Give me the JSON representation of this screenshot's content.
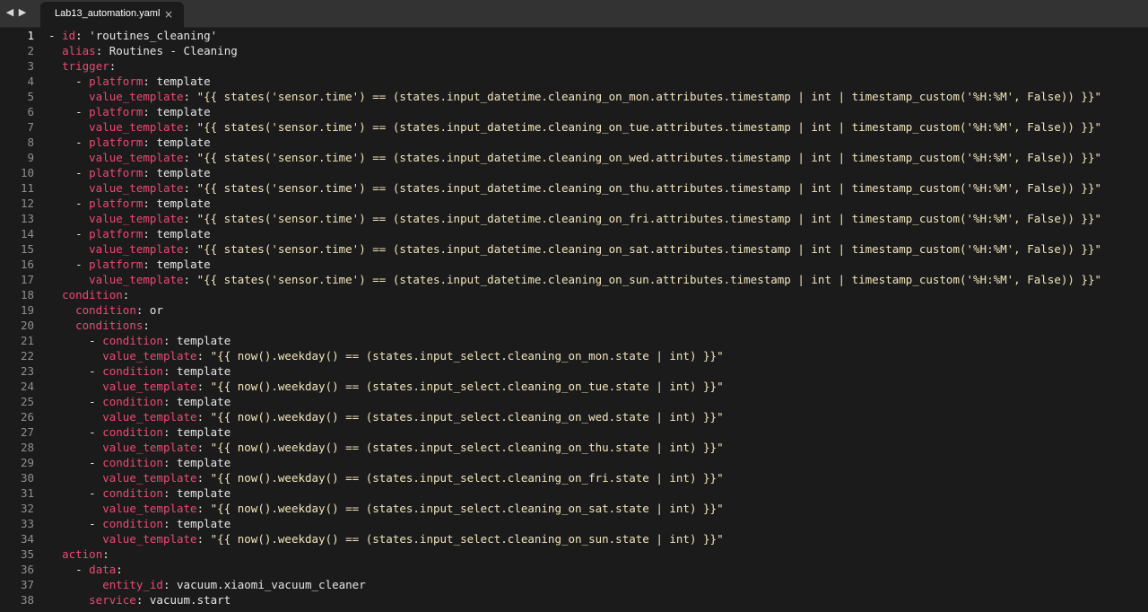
{
  "tab": {
    "title": "Lab13_automation.yaml",
    "close_glyph": "×"
  },
  "nav": {
    "back_glyph": "◀",
    "forward_glyph": "▶"
  },
  "colors": {
    "key": "#ec4a73",
    "text": "#e6e6e6",
    "string": "#f2e5bc",
    "background": "#1b1b1b",
    "tabbar": "#333333"
  },
  "editor": {
    "current_line": 1,
    "lines": [
      {
        "n": "1",
        "indent": "",
        "dash": "- ",
        "key": "id",
        "value": "'routines_cleaning'"
      },
      {
        "n": "2",
        "indent": "  ",
        "dash": "",
        "key": "alias",
        "value": "Routines - Cleaning"
      },
      {
        "n": "3",
        "indent": "  ",
        "dash": "",
        "key": "trigger",
        "value": ""
      },
      {
        "n": "4",
        "indent": "    ",
        "dash": "- ",
        "key": "platform",
        "value": "template"
      },
      {
        "n": "5",
        "indent": "      ",
        "dash": "",
        "key": "value_template",
        "value": "\"{{ states('sensor.time') == (states.input_datetime.cleaning_on_mon.attributes.timestamp | int | timestamp_custom('%H:%M', False)) }}\""
      },
      {
        "n": "6",
        "indent": "    ",
        "dash": "- ",
        "key": "platform",
        "value": "template"
      },
      {
        "n": "7",
        "indent": "      ",
        "dash": "",
        "key": "value_template",
        "value": "\"{{ states('sensor.time') == (states.input_datetime.cleaning_on_tue.attributes.timestamp | int | timestamp_custom('%H:%M', False)) }}\""
      },
      {
        "n": "8",
        "indent": "    ",
        "dash": "- ",
        "key": "platform",
        "value": "template"
      },
      {
        "n": "9",
        "indent": "      ",
        "dash": "",
        "key": "value_template",
        "value": "\"{{ states('sensor.time') == (states.input_datetime.cleaning_on_wed.attributes.timestamp | int | timestamp_custom('%H:%M', False)) }}\""
      },
      {
        "n": "10",
        "indent": "    ",
        "dash": "- ",
        "key": "platform",
        "value": "template"
      },
      {
        "n": "11",
        "indent": "      ",
        "dash": "",
        "key": "value_template",
        "value": "\"{{ states('sensor.time') == (states.input_datetime.cleaning_on_thu.attributes.timestamp | int | timestamp_custom('%H:%M', False)) }}\""
      },
      {
        "n": "12",
        "indent": "    ",
        "dash": "- ",
        "key": "platform",
        "value": "template"
      },
      {
        "n": "13",
        "indent": "      ",
        "dash": "",
        "key": "value_template",
        "value": "\"{{ states('sensor.time') == (states.input_datetime.cleaning_on_fri.attributes.timestamp | int | timestamp_custom('%H:%M', False)) }}\""
      },
      {
        "n": "14",
        "indent": "    ",
        "dash": "- ",
        "key": "platform",
        "value": "template"
      },
      {
        "n": "15",
        "indent": "      ",
        "dash": "",
        "key": "value_template",
        "value": "\"{{ states('sensor.time') == (states.input_datetime.cleaning_on_sat.attributes.timestamp | int | timestamp_custom('%H:%M', False)) }}\""
      },
      {
        "n": "16",
        "indent": "    ",
        "dash": "- ",
        "key": "platform",
        "value": "template"
      },
      {
        "n": "17",
        "indent": "      ",
        "dash": "",
        "key": "value_template",
        "value": "\"{{ states('sensor.time') == (states.input_datetime.cleaning_on_sun.attributes.timestamp | int | timestamp_custom('%H:%M', False)) }}\""
      },
      {
        "n": "18",
        "indent": "  ",
        "dash": "",
        "key": "condition",
        "value": ""
      },
      {
        "n": "19",
        "indent": "    ",
        "dash": "",
        "key": "condition",
        "value": "or"
      },
      {
        "n": "20",
        "indent": "    ",
        "dash": "",
        "key": "conditions",
        "value": ""
      },
      {
        "n": "21",
        "indent": "      ",
        "dash": "- ",
        "key": "condition",
        "value": "template"
      },
      {
        "n": "22",
        "indent": "        ",
        "dash": "",
        "key": "value_template",
        "value": "\"{{ now().weekday() == (states.input_select.cleaning_on_mon.state | int) }}\""
      },
      {
        "n": "23",
        "indent": "      ",
        "dash": "- ",
        "key": "condition",
        "value": "template"
      },
      {
        "n": "24",
        "indent": "        ",
        "dash": "",
        "key": "value_template",
        "value": "\"{{ now().weekday() == (states.input_select.cleaning_on_tue.state | int) }}\""
      },
      {
        "n": "25",
        "indent": "      ",
        "dash": "- ",
        "key": "condition",
        "value": "template"
      },
      {
        "n": "26",
        "indent": "        ",
        "dash": "",
        "key": "value_template",
        "value": "\"{{ now().weekday() == (states.input_select.cleaning_on_wed.state | int) }}\""
      },
      {
        "n": "27",
        "indent": "      ",
        "dash": "- ",
        "key": "condition",
        "value": "template"
      },
      {
        "n": "28",
        "indent": "        ",
        "dash": "",
        "key": "value_template",
        "value": "\"{{ now().weekday() == (states.input_select.cleaning_on_thu.state | int) }}\""
      },
      {
        "n": "29",
        "indent": "      ",
        "dash": "- ",
        "key": "condition",
        "value": "template"
      },
      {
        "n": "30",
        "indent": "        ",
        "dash": "",
        "key": "value_template",
        "value": "\"{{ now().weekday() == (states.input_select.cleaning_on_fri.state | int) }}\""
      },
      {
        "n": "31",
        "indent": "      ",
        "dash": "- ",
        "key": "condition",
        "value": "template"
      },
      {
        "n": "32",
        "indent": "        ",
        "dash": "",
        "key": "value_template",
        "value": "\"{{ now().weekday() == (states.input_select.cleaning_on_sat.state | int) }}\""
      },
      {
        "n": "33",
        "indent": "      ",
        "dash": "- ",
        "key": "condition",
        "value": "template"
      },
      {
        "n": "34",
        "indent": "        ",
        "dash": "",
        "key": "value_template",
        "value": "\"{{ now().weekday() == (states.input_select.cleaning_on_sun.state | int) }}\""
      },
      {
        "n": "35",
        "indent": "  ",
        "dash": "",
        "key": "action",
        "value": ""
      },
      {
        "n": "36",
        "indent": "    ",
        "dash": "- ",
        "key": "data",
        "value": ""
      },
      {
        "n": "37",
        "indent": "        ",
        "dash": "",
        "key": "entity_id",
        "value": "vacuum.xiaomi_vacuum_cleaner"
      },
      {
        "n": "38",
        "indent": "      ",
        "dash": "",
        "key": "service",
        "value": "vacuum.start"
      }
    ]
  }
}
